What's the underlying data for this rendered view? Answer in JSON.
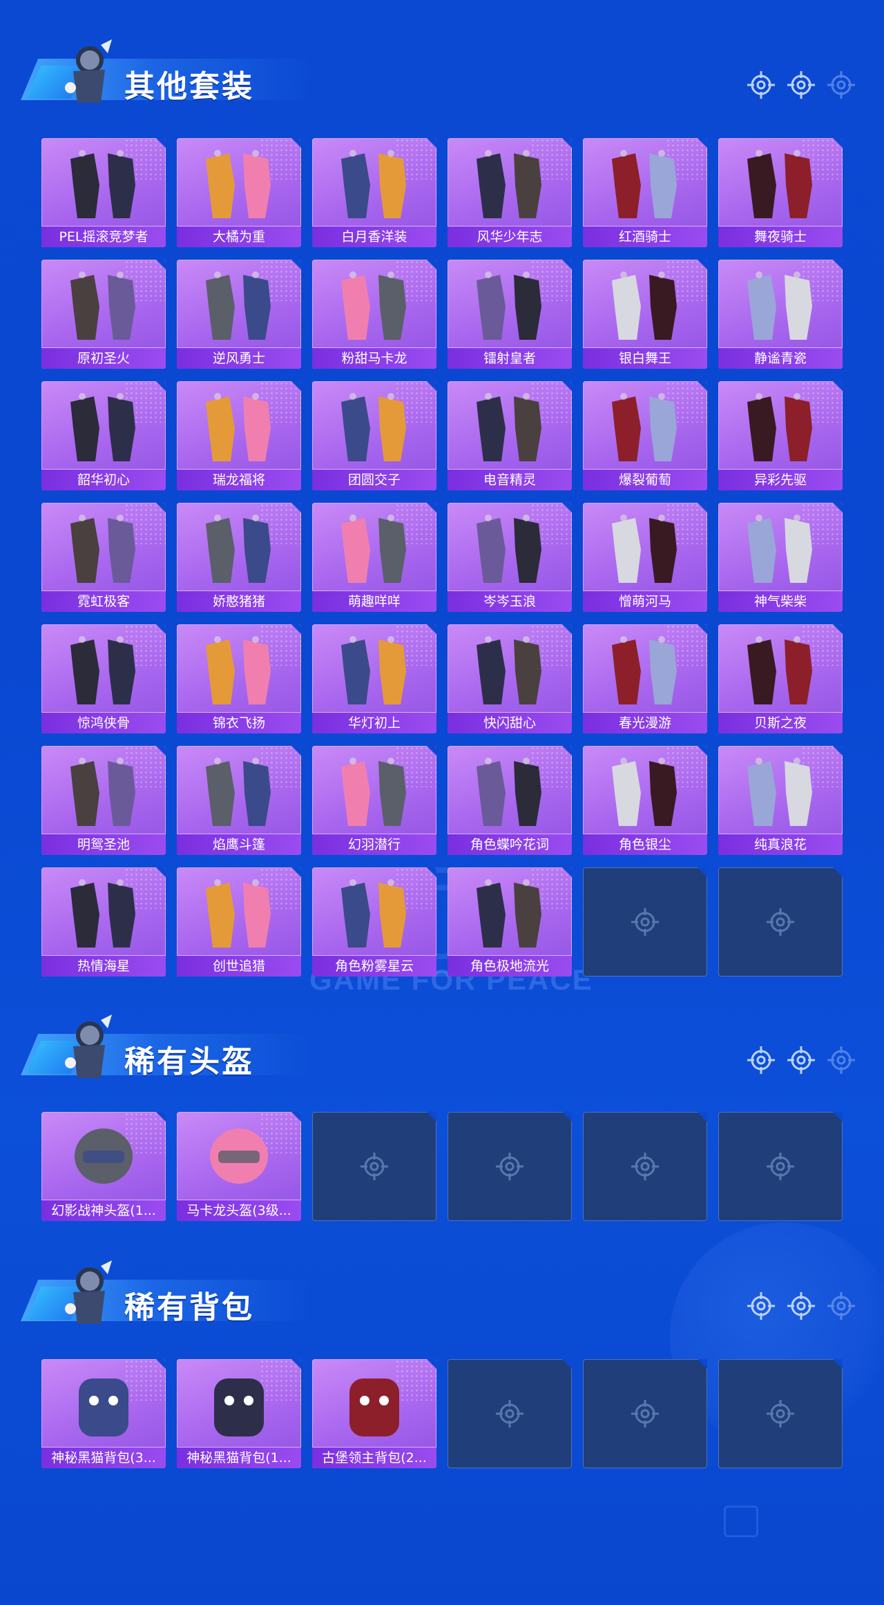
{
  "watermark_text": "GAME FOR PEACE",
  "colors": {
    "bg": "#0b49d3",
    "card": "#a866ee",
    "label_bar": "#7a2fe0",
    "empty_slot": "#203f7a"
  },
  "sections": [
    {
      "title": "其他套装",
      "items": [
        "PEL摇滚竞梦者",
        "大橘为重",
        "白月香洋装",
        "风华少年志",
        "红酒骑士",
        "舞夜骑士",
        "原初圣火",
        "逆风勇士",
        "粉甜马卡龙",
        "镭射皇者",
        "银白舞王",
        "静谧青瓷",
        "韶华初心",
        "瑞龙福将",
        "团圆交子",
        "电音精灵",
        "爆裂葡萄",
        "异彩先驱",
        "霓虹极客",
        "娇憨猪猪",
        "萌趣咩咩",
        "岑岑玉浪",
        "憎萌河马",
        "神气柴柴",
        "惊鸿侠骨",
        "锦衣飞扬",
        "华灯初上",
        "快闪甜心",
        "春光漫游",
        "贝斯之夜",
        "明鸳圣池",
        "焰鹰斗篷",
        "幻羽潜行",
        "角色蝶吟花词",
        "角色银尘",
        "纯真浪花",
        "热情海星",
        "创世追猎",
        "角色粉雾星云",
        "角色极地流光"
      ],
      "empty_slots": 2
    },
    {
      "title": "稀有头盔",
      "items": [
        "幻影战神头盔(1...",
        "马卡龙头盔(3级..."
      ],
      "empty_slots": 4
    },
    {
      "title": "稀有背包",
      "items": [
        "神秘黑猫背包(3...",
        "神秘黑猫背包(1...",
        "古堡领主背包(2..."
      ],
      "empty_slots": 3
    }
  ]
}
